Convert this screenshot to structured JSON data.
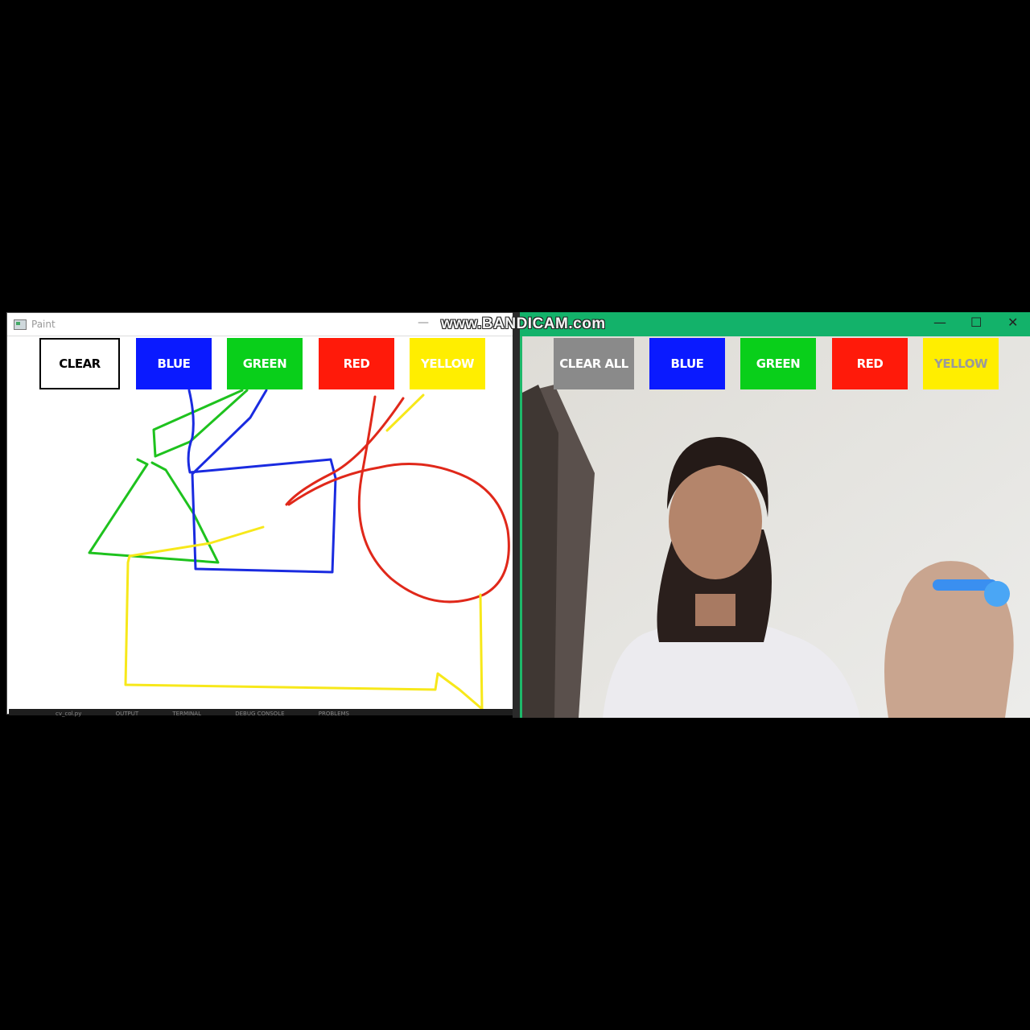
{
  "watermark": "www.BANDICAM.com",
  "paint_window": {
    "title": "Paint",
    "minimize_label": "—",
    "buttons": [
      {
        "label": "CLEAR",
        "bg": "#ffffff",
        "fg": "#000000"
      },
      {
        "label": "BLUE",
        "bg": "#0a1aff",
        "fg": "#ffffff"
      },
      {
        "label": "GREEN",
        "bg": "#09cf1a",
        "fg": "#ffffff"
      },
      {
        "label": "RED",
        "bg": "#ff1a0a",
        "fg": "#ffffff"
      },
      {
        "label": "YELLOW",
        "bg": "#ffee00",
        "fg": "#ffffff"
      }
    ],
    "stroke_colors": {
      "blue": "#1a2be0",
      "green": "#1ec21e",
      "red": "#e0281a",
      "yellow": "#f7e81a"
    },
    "status_strip": [
      "cv_col.py",
      "OUTPUT",
      "TERMINAL",
      "DEBUG CONSOLE",
      "PROBLEMS"
    ]
  },
  "camera_window": {
    "controls": {
      "minimize": "—",
      "maximize": "☐",
      "close": "✕"
    },
    "title_color": "#13b26a",
    "buttons": [
      {
        "label": "CLEAR ALL",
        "bg": "#8a8a8a",
        "fg": "#ffffff"
      },
      {
        "label": "BLUE",
        "bg": "#0a1aff",
        "fg": "#ffffff"
      },
      {
        "label": "GREEN",
        "bg": "#09cf1a",
        "fg": "#ffffff"
      },
      {
        "label": "RED",
        "bg": "#ff1a0a",
        "fg": "#ffffff"
      },
      {
        "label": "YELLOW",
        "bg": "#ffee00",
        "fg": "#9a9a9a"
      }
    ]
  }
}
